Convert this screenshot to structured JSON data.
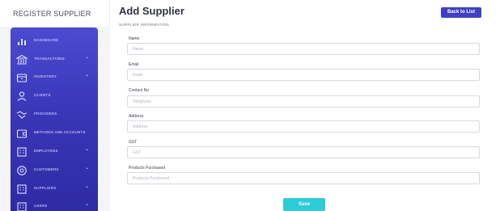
{
  "brand": {
    "title": "REGISTER SUPPLIER"
  },
  "sidebar": {
    "items": [
      {
        "label": "DASHBOARD",
        "icon": "chart-icon",
        "has_submenu": false
      },
      {
        "label": "TRANSACTIONS",
        "icon": "bank-icon",
        "has_submenu": true
      },
      {
        "label": "INVENTORY",
        "icon": "box-icon",
        "has_submenu": true
      },
      {
        "label": "CLIENTS",
        "icon": "user-icon",
        "has_submenu": false
      },
      {
        "label": "PROVIDERS",
        "icon": "handshake-icon",
        "has_submenu": false
      },
      {
        "label": "METHODS AND ACCOUNTS",
        "icon": "wallet-icon",
        "has_submenu": false
      },
      {
        "label": "EMPLOYEES",
        "icon": "building-icon",
        "has_submenu": true
      },
      {
        "label": "CUSTOMERS",
        "icon": "target-icon",
        "has_submenu": true
      },
      {
        "label": "SUPPLIERS",
        "icon": "building-icon",
        "has_submenu": true
      },
      {
        "label": "USERS",
        "icon": "building-icon",
        "has_submenu": true
      }
    ],
    "caret": "⌄"
  },
  "main": {
    "title": "Add Supplier",
    "subtitle": "SUPPLIER INFORMATION",
    "back_button": "Back to List",
    "fields": [
      {
        "label": "Name",
        "placeholder": "Name",
        "value": ""
      },
      {
        "label": "Email",
        "placeholder": "Email",
        "value": ""
      },
      {
        "label": "Contact No",
        "placeholder": "Telephone",
        "value": ""
      },
      {
        "label": "Address",
        "placeholder": "Address",
        "value": ""
      },
      {
        "label": "GST",
        "placeholder": "GST",
        "value": ""
      },
      {
        "label": "Products Purchased",
        "placeholder": "Products Purchased",
        "value": ""
      }
    ],
    "save_button": "Save"
  },
  "colors": {
    "sidebar_top": "#4b4bd1",
    "sidebar_bottom": "#2e2ba4",
    "back_button": "#3f3fc5",
    "save_button": "#2ecbd9"
  }
}
